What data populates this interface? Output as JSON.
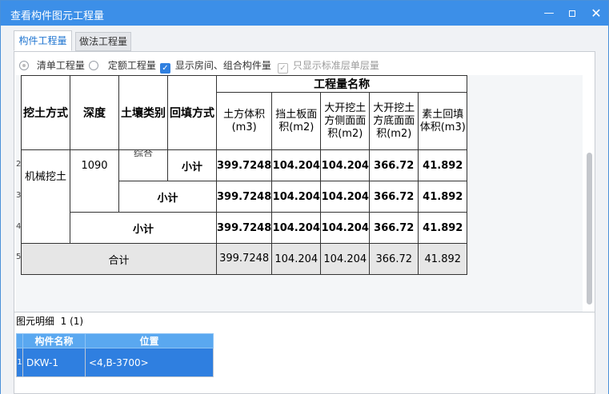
{
  "window": {
    "title": "查看构件图元工程量"
  },
  "titlebar": {
    "minimize": "—",
    "close": "✕"
  },
  "tabs": [
    {
      "label": "构件工程量"
    },
    {
      "label": "做法工程量"
    }
  ],
  "options": {
    "radio_list": "清单工程量",
    "radio_quota": "定额工程量",
    "check_rooms": "显示房间、组合构件量",
    "check_standard": "只显示标准层单层量"
  },
  "table": {
    "group_header": "工程量名称",
    "headers": [
      "挖土方式",
      "深度",
      "土壤类别",
      "回填方式"
    ],
    "qty_headers": [
      "土方体积(m3)",
      "挡土板面积(m2)",
      "大开挖土方侧面面积(m2)",
      "大开挖土方底面面积(m2)",
      "素土回填体积(m3)"
    ],
    "row_numbers": [
      "2",
      "3",
      "4",
      "5"
    ],
    "method": "机械挖土",
    "depth": "1090",
    "soil_clipped": "综合",
    "subtotal": "小计",
    "total": "合计",
    "values_bold": [
      "399.7248",
      "104.204",
      "104.204",
      "366.72",
      "41.892"
    ],
    "values_total": [
      "399.7248",
      "104.204",
      "104.204",
      "366.72",
      "41.892"
    ]
  },
  "detail": {
    "title": "图元明细",
    "count": "1 (1)",
    "columns": [
      "构件名称",
      "位置"
    ],
    "rows": [
      {
        "num": "1",
        "name": "DKW-1",
        "position": "<4,B-3700>"
      }
    ]
  }
}
